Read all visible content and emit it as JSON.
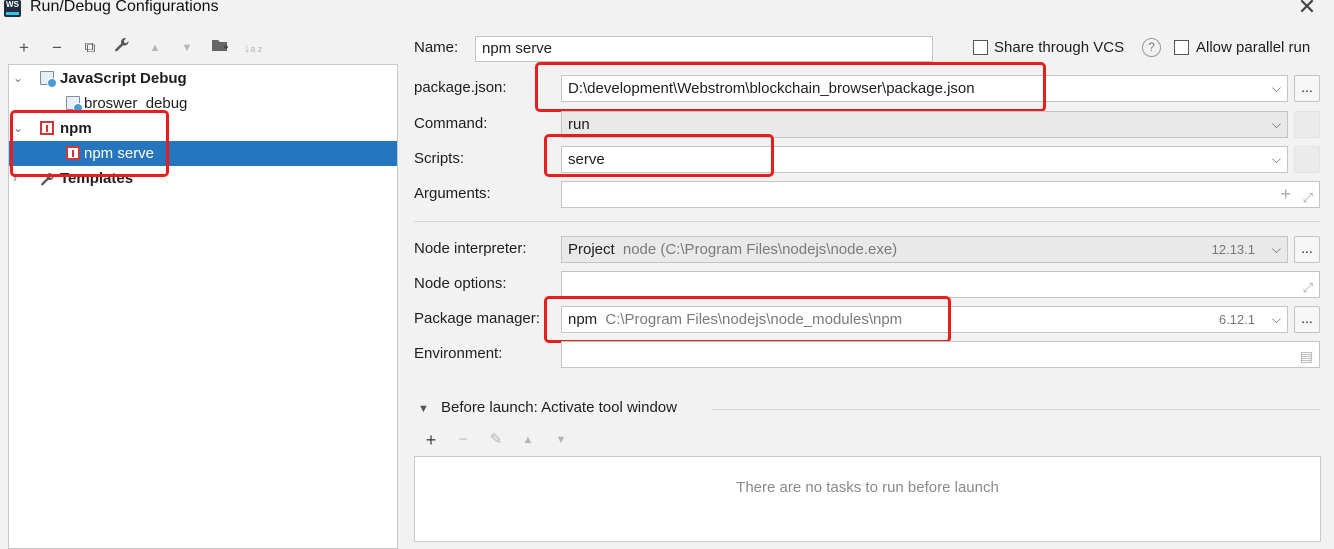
{
  "window": {
    "title": "Run/Debug Configurations",
    "app_icon_label": "WS"
  },
  "toolbar": {
    "add": "+",
    "remove": "−",
    "copy": "⧉",
    "edit": "🔧",
    "up": "▲",
    "down": "▼",
    "folder": "📁",
    "sort": "↓"
  },
  "tree": {
    "group1": "JavaScript Debug",
    "item1": "broswer_debug",
    "group2": "npm",
    "item2": "npm serve",
    "group3": "Templates"
  },
  "form": {
    "name_label": "Name:",
    "name_value": "npm serve",
    "share_label": "Share through VCS",
    "help": "?",
    "parallel_label": "Allow parallel run",
    "package_json_label": "package.json:",
    "package_json_value": "D:\\development\\Webstrom\\blockchain_browser\\package.json",
    "command_label": "Command:",
    "command_value": "run",
    "scripts_label": "Scripts:",
    "scripts_value": "serve",
    "arguments_label": "Arguments:",
    "arguments_value": "",
    "node_interpreter_label": "Node interpreter:",
    "node_interpreter_prefix": "Project",
    "node_interpreter_path": "node (C:\\Program Files\\nodejs\\node.exe)",
    "node_interpreter_version": "12.13.1",
    "node_options_label": "Node options:",
    "node_options_value": "",
    "package_manager_label": "Package manager:",
    "package_manager_prefix": "npm",
    "package_manager_path": "C:\\Program Files\\nodejs\\node_modules\\npm",
    "package_manager_version": "6.12.1",
    "environment_label": "Environment:",
    "environment_value": "",
    "browse": "..."
  },
  "before_launch": {
    "title": "Before launch: Activate tool window",
    "empty_message": "There are no tasks to run before launch",
    "add": "+",
    "remove": "−",
    "edit": "✎",
    "up": "▲",
    "down": "▼"
  },
  "colors": {
    "selection": "#2675bf",
    "highlight": "#e81e1e",
    "npm": "#cb3837"
  }
}
